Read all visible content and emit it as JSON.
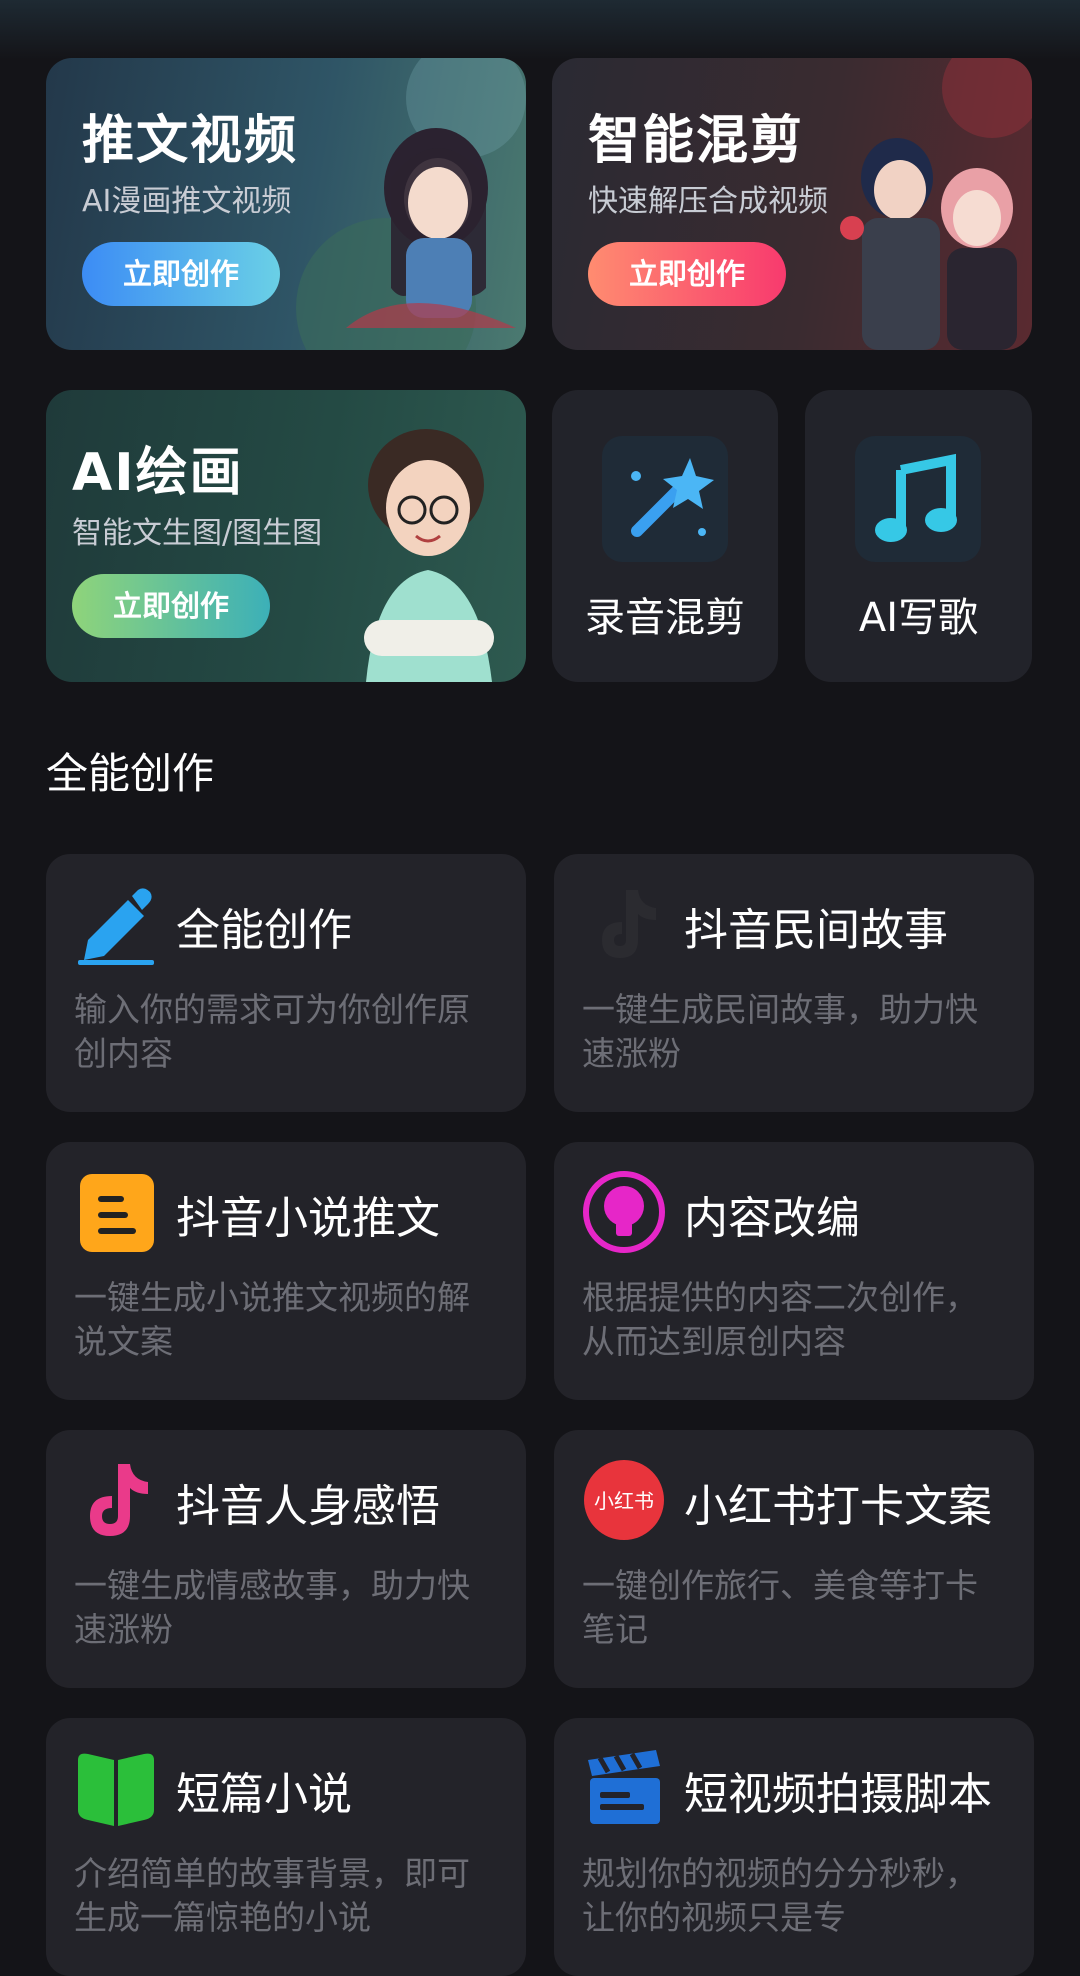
{
  "hero": [
    {
      "title": "推文视频",
      "subtitle": "AI漫画推文视频",
      "button": "立即创作"
    },
    {
      "title": "智能混剪",
      "subtitle": "快速解压合成视频",
      "button": "立即创作"
    },
    {
      "title": "AI绘画",
      "subtitle": "智能文生图/图生图",
      "button": "立即创作"
    }
  ],
  "tools": [
    {
      "label": "录音混剪",
      "icon": "magic-wand-icon"
    },
    {
      "label": "AI写歌",
      "icon": "music-note-icon"
    }
  ],
  "section": {
    "title": "全能创作"
  },
  "features": [
    {
      "title": "全能创作",
      "desc": "输入你的需求可为你创作原创内容",
      "icon": "pencil-icon"
    },
    {
      "title": "抖音民间故事",
      "desc": "一键生成民间故事，助力快速涨粉",
      "icon": "tiktok-icon"
    },
    {
      "title": "抖音小说推文",
      "desc": "一键生成小说推文视频的解说文案",
      "icon": "document-icon"
    },
    {
      "title": "内容改编",
      "desc": "根据提供的内容二次创作，从而达到原创内容",
      "icon": "lightbulb-icon"
    },
    {
      "title": "抖音人身感悟",
      "desc": "一键生成情感故事，助力快速涨粉",
      "icon": "tiktok-icon"
    },
    {
      "title": "小红书打卡文案",
      "desc": "一键创作旅行、美食等打卡笔记",
      "icon": "xiaohongshu-icon",
      "icon_text": "小红书"
    },
    {
      "title": "短篇小说",
      "desc": "介绍简单的故事背景，即可生成一篇惊艳的小说",
      "icon": "book-icon"
    },
    {
      "title": "短视频拍摄脚本",
      "desc": "规划你的视频的分分秒秒，让你的视频只是专",
      "icon": "clapperboard-icon"
    }
  ]
}
